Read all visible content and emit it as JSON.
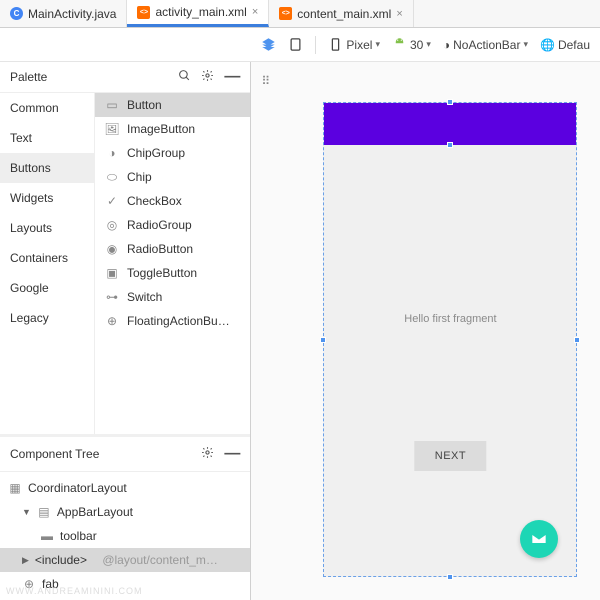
{
  "tabs": [
    {
      "icon": "C",
      "label": "MainActivity.java"
    },
    {
      "icon": "xml",
      "label": "activity_main.xml",
      "active": true
    },
    {
      "icon": "xml",
      "label": "content_main.xml"
    }
  ],
  "palette": {
    "title": "Palette",
    "categories": [
      "Common",
      "Text",
      "Buttons",
      "Widgets",
      "Layouts",
      "Containers",
      "Google",
      "Legacy"
    ],
    "selected_category": "Buttons",
    "items": [
      {
        "icon": "button",
        "label": "Button",
        "selected": true
      },
      {
        "icon": "imgbtn",
        "label": "ImageButton"
      },
      {
        "icon": "chipgrp",
        "label": "ChipGroup"
      },
      {
        "icon": "chip",
        "label": "Chip"
      },
      {
        "icon": "check",
        "label": "CheckBox"
      },
      {
        "icon": "radiogrp",
        "label": "RadioGroup"
      },
      {
        "icon": "radio",
        "label": "RadioButton"
      },
      {
        "icon": "toggle",
        "label": "ToggleButton"
      },
      {
        "icon": "switch",
        "label": "Switch"
      },
      {
        "icon": "fab",
        "label": "FloatingActionBu…"
      }
    ]
  },
  "component_tree": {
    "title": "Component Tree",
    "nodes": [
      {
        "icon": "coord",
        "label": "CoordinatorLayout",
        "depth": 0
      },
      {
        "icon": "appbar",
        "label": "AppBarLayout",
        "depth": 1,
        "expanded": true
      },
      {
        "icon": "toolbar",
        "label": "toolbar",
        "depth": 2
      },
      {
        "icon": "include",
        "label": "<include>",
        "suffix": "@layout/content_m…",
        "depth": 1,
        "selected": true
      },
      {
        "icon": "fab",
        "label": "fab",
        "depth": 1
      }
    ]
  },
  "toolbar": {
    "device": "Pixel",
    "api": "30",
    "theme": "NoActionBar",
    "locale": "Defau"
  },
  "preview": {
    "text": "Hello first fragment",
    "button": "NEXT"
  },
  "watermark": "WWW.ANDREAMININI.COM"
}
